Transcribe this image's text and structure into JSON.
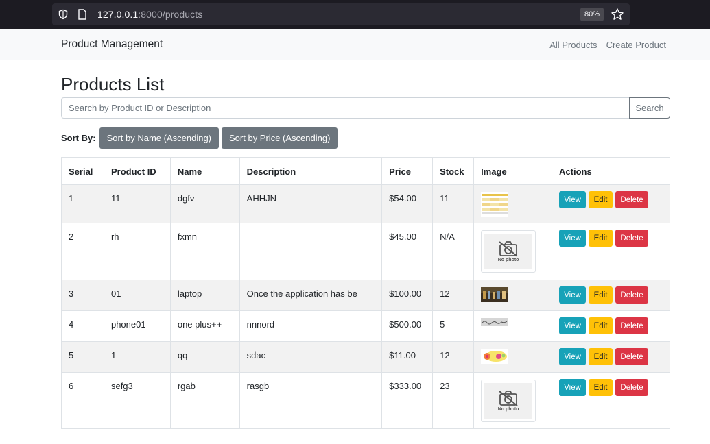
{
  "browser": {
    "url_host": "127.0.0.1",
    "url_path": ":8000/products",
    "zoom": "80%"
  },
  "navbar": {
    "brand": "Product Management",
    "links": [
      "All Products",
      "Create Product"
    ]
  },
  "page": {
    "title": "Products List",
    "search_placeholder": "Search by Product ID or Description",
    "search_button": "Search",
    "sort_label": "Sort By:",
    "sort_buttons": [
      "Sort by Name (Ascending)",
      "Sort by Price (Ascending)"
    ]
  },
  "table": {
    "headers": [
      "Serial",
      "Product ID",
      "Name",
      "Description",
      "Price",
      "Stock",
      "Image",
      "Actions"
    ],
    "rows": [
      {
        "serial": "1",
        "product_id": "11",
        "name": "dgfv",
        "description": "AHHJN",
        "price": "$54.00",
        "stock": "11",
        "image": "spreadsheet-thumbnail"
      },
      {
        "serial": "2",
        "product_id": "rh",
        "name": "fxmn",
        "description": "",
        "price": "$45.00",
        "stock": "N/A",
        "image": "no-photo"
      },
      {
        "serial": "3",
        "product_id": "01",
        "name": "laptop",
        "description": "Once the application has be",
        "price": "$100.00",
        "stock": "12",
        "image": "painting-thumbnail"
      },
      {
        "serial": "4",
        "product_id": "phone01",
        "name": "one plus++",
        "description": "nnnord",
        "price": "$500.00",
        "stock": "5",
        "image": "signature-thumbnail"
      },
      {
        "serial": "5",
        "product_id": "1",
        "name": "qq",
        "description": "sdac",
        "price": "$11.00",
        "stock": "12",
        "image": "colorful-thumbnail"
      },
      {
        "serial": "6",
        "product_id": "sefg3",
        "name": "rgab",
        "description": "rasgb",
        "price": "$333.00",
        "stock": "23",
        "image": "no-photo"
      }
    ],
    "action_labels": {
      "view": "View",
      "edit": "Edit",
      "delete": "Delete"
    },
    "no_photo_text": "No photo"
  }
}
